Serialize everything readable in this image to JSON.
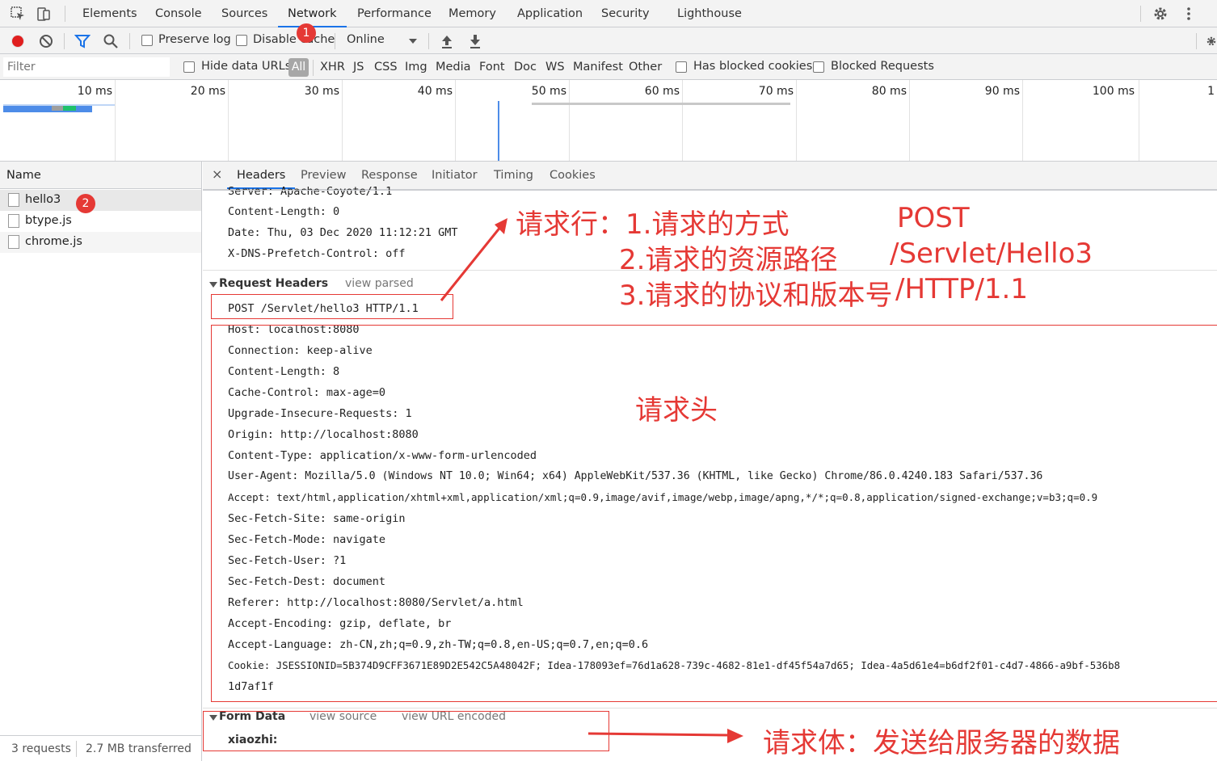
{
  "tabs": [
    "Elements",
    "Console",
    "Sources",
    "Network",
    "Performance",
    "Memory",
    "Application",
    "Security",
    "Lighthouse"
  ],
  "active_tab": "Network",
  "toolbar": {
    "preserve_log": "Preserve log",
    "disable_cache": "Disable cache",
    "throttle": "Online"
  },
  "filter": {
    "placeholder": "Filter",
    "hide_data_urls": "Hide data URLs",
    "types": [
      "All",
      "XHR",
      "JS",
      "CSS",
      "Img",
      "Media",
      "Font",
      "Doc",
      "WS",
      "Manifest",
      "Other"
    ],
    "has_blocked_cookies": "Has blocked cookies",
    "blocked_requests": "Blocked Requests"
  },
  "overview": {
    "ticks": [
      "10 ms",
      "20 ms",
      "30 ms",
      "40 ms",
      "50 ms",
      "60 ms",
      "70 ms",
      "80 ms",
      "90 ms",
      "100 ms",
      "1"
    ]
  },
  "requests": {
    "header": "Name",
    "items": [
      "hello3",
      "btype.js",
      "chrome.js"
    ],
    "summary_count": "3 requests",
    "summary_size": "2.7 MB transferred"
  },
  "detail": {
    "tabs": [
      "Headers",
      "Preview",
      "Response",
      "Initiator",
      "Timing",
      "Cookies"
    ],
    "close": "×",
    "response_headers": [
      "Server: Apache-Coyote/1.1",
      "Content-Length: 0",
      "Date: Thu, 03 Dec 2020 11:12:21 GMT",
      "X-DNS-Prefetch-Control: off"
    ],
    "request_headers_title": "Request Headers",
    "view_parsed": "view parsed",
    "request_line": "POST /Servlet/hello3 HTTP/1.1",
    "request_headers": [
      "Host: localhost:8080",
      "Connection: keep-alive",
      "Content-Length: 8",
      "Cache-Control: max-age=0",
      "Upgrade-Insecure-Requests: 1",
      "Origin: http://localhost:8080",
      "Content-Type: application/x-www-form-urlencoded",
      "User-Agent: Mozilla/5.0 (Windows NT 10.0; Win64; x64) AppleWebKit/537.36 (KHTML, like Gecko) Chrome/86.0.4240.183 Safari/537.36",
      "Accept: text/html,application/xhtml+xml,application/xml;q=0.9,image/avif,image/webp,image/apng,*/*;q=0.8,application/signed-exchange;v=b3;q=0.9",
      "Sec-Fetch-Site: same-origin",
      "Sec-Fetch-Mode: navigate",
      "Sec-Fetch-User: ?1",
      "Sec-Fetch-Dest: document",
      "Referer: http://localhost:8080/Servlet/a.html",
      "Accept-Encoding: gzip, deflate, br",
      "Accept-Language: zh-CN,zh;q=0.9,zh-TW;q=0.8,en-US;q=0.7,en;q=0.6",
      "Cookie: JSESSIONID=5B374D9CFF3671E89D2E542C5A48042F; Idea-178093ef=76d1a628-739c-4682-81e1-df45f54a7d65; Idea-4a5d61e4=b6df2f01-c4d7-4866-a9bf-536b8",
      "1d7af1f"
    ],
    "form_data_title": "Form Data",
    "view_source": "view source",
    "view_url_encoded": "view URL encoded",
    "form_field": "xiaozhi:"
  },
  "annotations": {
    "badge1": "1",
    "badge2": "2",
    "req_line_label": "请求行：1.请求的方式",
    "req_line_2": "2.请求的资源路径",
    "req_line_3": "3.请求的协议和版本号",
    "method": "POST",
    "path": "/Servlet/Hello3",
    "protocol": "/HTTP/1.1",
    "headers_label": "请求头",
    "body_label": "请求体：发送给服务器的数据",
    "color": "#e53935"
  }
}
